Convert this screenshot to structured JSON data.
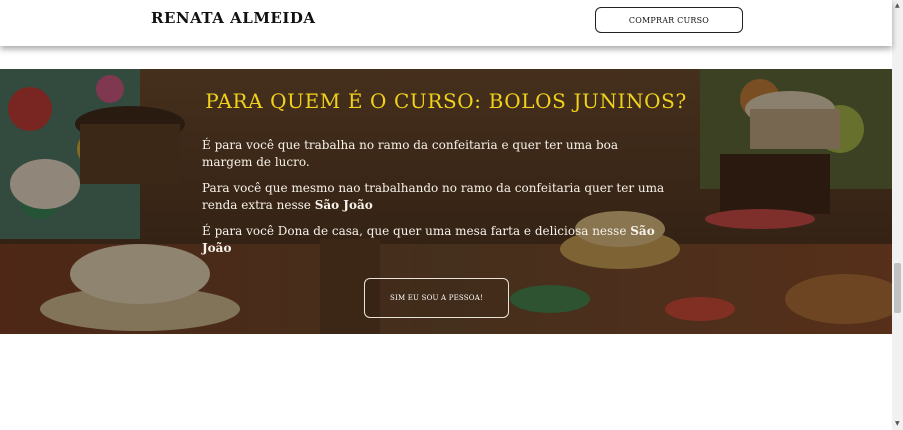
{
  "header": {
    "brand": "RENATA ALMEIDA",
    "cta_label": "COMPRAR CURSO"
  },
  "hero": {
    "title": "PARA QUEM É O CURSO: BOLOS JUNINOS?",
    "paragraphs": [
      {
        "text": "É para você que trabalha no ramo da confeitaria e quer ter uma boa margem de lucro.",
        "bold": ""
      },
      {
        "text": "Para você que mesmo nao trabalhando no ramo da confeitaria quer ter uma renda extra nesse ",
        "bold": "São João"
      },
      {
        "text": "É para você Dona de casa, que quer uma mesa farta e deliciosa nesse ",
        "bold": "São João"
      }
    ],
    "cta_label": "SIM EU SOU A PESSOA!"
  },
  "colors": {
    "title_yellow": "#f1d21b",
    "hero_text": "#f7f2ea"
  },
  "icons": {
    "scroll_up": "triangle-up-icon",
    "scroll_down": "triangle-down-icon"
  }
}
